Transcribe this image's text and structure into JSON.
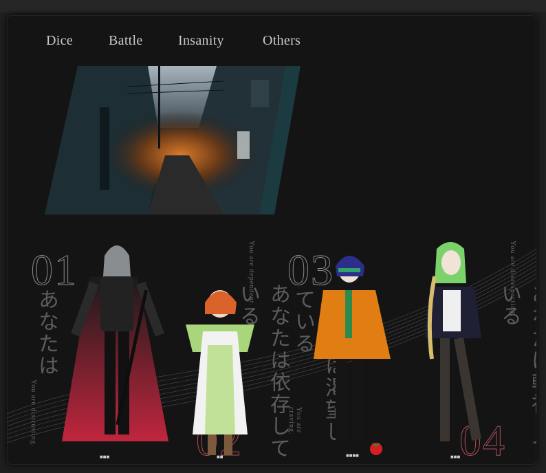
{
  "nav": {
    "items": [
      {
        "label": "Dice"
      },
      {
        "label": "Battle"
      },
      {
        "label": "Insanity"
      },
      {
        "label": "Others"
      }
    ]
  },
  "characters": [
    {
      "number": "01",
      "jp": "あなたは",
      "en": "You are distrusting."
    },
    {
      "number": "02",
      "jp": "あなたは依存している",
      "en": "You are dependent."
    },
    {
      "number": "03",
      "jp": "あなたは渇望している",
      "en": "You are craving."
    },
    {
      "number": "04",
      "jp": "あなたは軽視している",
      "en": "You are disrespecting."
    }
  ],
  "colors": {
    "panel": "#141414",
    "nav_text": "#c9c9c9",
    "accent_red": "#b04f5b",
    "hero_frame": "#1b3b40"
  }
}
